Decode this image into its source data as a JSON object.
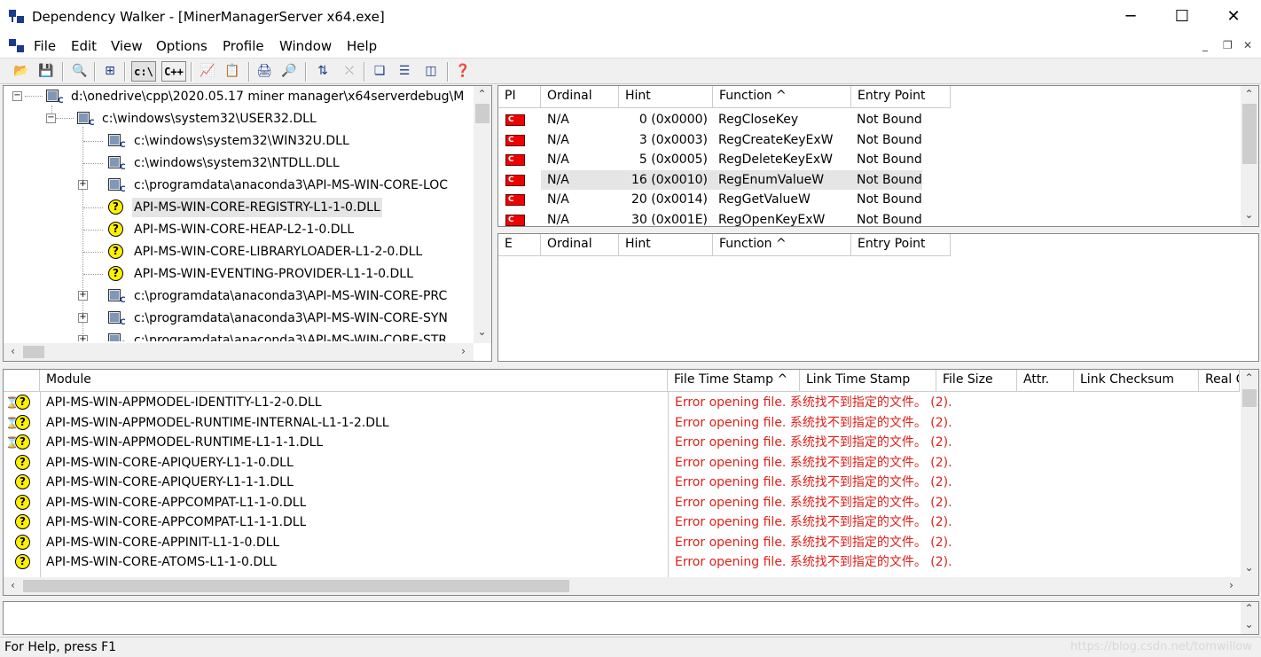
{
  "window": {
    "title": "Dependency Walker - [MinerManagerServer x64.exe]",
    "controls": [
      "─",
      "☐",
      "✕"
    ]
  },
  "menubar": {
    "items": [
      "File",
      "Edit",
      "View",
      "Options",
      "Profile",
      "Window",
      "Help"
    ],
    "mdi_controls": [
      "_",
      "❐",
      "✕"
    ]
  },
  "toolbar": {
    "buttons": [
      {
        "name": "open-icon",
        "glyph": "📂"
      },
      {
        "name": "save-icon",
        "glyph": "💾"
      },
      {
        "name": "find-icon",
        "glyph": "🔍"
      },
      {
        "name": "tree-icon",
        "glyph": "⊞"
      },
      {
        "name": "full-paths-button",
        "glyph": "c:\\"
      },
      {
        "name": "cpp-undecorate-button",
        "glyph": "C++"
      },
      {
        "name": "chart-icon",
        "glyph": "📈"
      },
      {
        "name": "properties-icon",
        "glyph": "📋"
      },
      {
        "name": "print-icon",
        "glyph": "🖨"
      },
      {
        "name": "view-icon",
        "glyph": "🔎"
      },
      {
        "name": "sort-icon",
        "glyph": "⇅"
      },
      {
        "name": "stop-icon",
        "glyph": "⛌"
      },
      {
        "name": "cascade-icon",
        "glyph": "❏"
      },
      {
        "name": "tile-horizontal-icon",
        "glyph": "☰"
      },
      {
        "name": "tile-vertical-icon",
        "glyph": "◫"
      },
      {
        "name": "help-icon",
        "glyph": "❓"
      }
    ]
  },
  "tree": {
    "nodes": [
      {
        "label": "d:\\onedrive\\cpp\\2020.05.17 miner manager\\x64serverdebug\\M",
        "icon": "module",
        "expander": "−"
      },
      {
        "label": "c:\\windows\\system32\\USER32.DLL",
        "icon": "module",
        "expander": "−"
      },
      {
        "label": "c:\\windows\\system32\\WIN32U.DLL",
        "icon": "module",
        "expander": ""
      },
      {
        "label": "c:\\windows\\system32\\NTDLL.DLL",
        "icon": "module",
        "expander": ""
      },
      {
        "label": "c:\\programdata\\anaconda3\\API-MS-WIN-CORE-LOC",
        "icon": "module",
        "expander": "+"
      },
      {
        "label": "API-MS-WIN-CORE-REGISTRY-L1-1-0.DLL",
        "icon": "missing",
        "expander": "",
        "selected": true
      },
      {
        "label": "API-MS-WIN-CORE-HEAP-L2-1-0.DLL",
        "icon": "missing",
        "expander": ""
      },
      {
        "label": "API-MS-WIN-CORE-LIBRARYLOADER-L1-2-0.DLL",
        "icon": "missing",
        "expander": ""
      },
      {
        "label": "API-MS-WIN-EVENTING-PROVIDER-L1-1-0.DLL",
        "icon": "missing",
        "expander": ""
      },
      {
        "label": "c:\\programdata\\anaconda3\\API-MS-WIN-CORE-PRC",
        "icon": "module",
        "expander": "+"
      },
      {
        "label": "c:\\programdata\\anaconda3\\API-MS-WIN-CORE-SYN",
        "icon": "module",
        "expander": "+"
      },
      {
        "label": "c:\\programdata\\anaconda3\\API-MS-WIN-CORE-STR",
        "icon": "module",
        "expander": "+"
      }
    ]
  },
  "imports": {
    "headers": [
      "PI",
      "Ordinal",
      "Hint",
      "Function ^",
      "Entry Point"
    ],
    "rows": [
      {
        "pi": "C",
        "ordinal": "N/A",
        "hint": "0 (0x0000)",
        "function": "RegCloseKey",
        "entry": "Not Bound"
      },
      {
        "pi": "C",
        "ordinal": "N/A",
        "hint": "3 (0x0003)",
        "function": "RegCreateKeyExW",
        "entry": "Not Bound"
      },
      {
        "pi": "C",
        "ordinal": "N/A",
        "hint": "5 (0x0005)",
        "function": "RegDeleteKeyExW",
        "entry": "Not Bound"
      },
      {
        "pi": "C",
        "ordinal": "N/A",
        "hint": "16 (0x0010)",
        "function": "RegEnumValueW",
        "entry": "Not Bound",
        "highlight": true
      },
      {
        "pi": "C",
        "ordinal": "N/A",
        "hint": "20 (0x0014)",
        "function": "RegGetValueW",
        "entry": "Not Bound"
      },
      {
        "pi": "C",
        "ordinal": "N/A",
        "hint": "30 (0x001E)",
        "function": "RegOpenKeyExW",
        "entry": "Not Bound"
      }
    ]
  },
  "exports": {
    "headers": [
      "E",
      "Ordinal",
      "Hint",
      "Function ^",
      "Entry Point"
    ]
  },
  "modules": {
    "headers": [
      "Module",
      "File Time Stamp ^",
      "Link Time Stamp",
      "File Size",
      "Attr.",
      "Link Checksum",
      "Real C"
    ],
    "rows": [
      {
        "icon": "hourglass-missing",
        "module": "API-MS-WIN-APPMODEL-IDENTITY-L1-2-0.DLL",
        "stamp": "Error opening file. 系统找不到指定的文件。 (2)."
      },
      {
        "icon": "hourglass-missing",
        "module": "API-MS-WIN-APPMODEL-RUNTIME-INTERNAL-L1-1-2.DLL",
        "stamp": "Error opening file. 系统找不到指定的文件。 (2)."
      },
      {
        "icon": "hourglass-missing",
        "module": "API-MS-WIN-APPMODEL-RUNTIME-L1-1-1.DLL",
        "stamp": "Error opening file. 系统找不到指定的文件。 (2)."
      },
      {
        "icon": "missing",
        "module": "API-MS-WIN-CORE-APIQUERY-L1-1-0.DLL",
        "stamp": "Error opening file. 系统找不到指定的文件。 (2)."
      },
      {
        "icon": "missing",
        "module": "API-MS-WIN-CORE-APIQUERY-L1-1-1.DLL",
        "stamp": "Error opening file. 系统找不到指定的文件。 (2)."
      },
      {
        "icon": "missing",
        "module": "API-MS-WIN-CORE-APPCOMPAT-L1-1-0.DLL",
        "stamp": "Error opening file. 系统找不到指定的文件。 (2)."
      },
      {
        "icon": "missing",
        "module": "API-MS-WIN-CORE-APPCOMPAT-L1-1-1.DLL",
        "stamp": "Error opening file. 系统找不到指定的文件。 (2)."
      },
      {
        "icon": "missing",
        "module": "API-MS-WIN-CORE-APPINIT-L1-1-0.DLL",
        "stamp": "Error opening file. 系统找不到指定的文件。 (2)."
      },
      {
        "icon": "missing",
        "module": "API-MS-WIN-CORE-ATOMS-L1-1-0.DLL",
        "stamp": "Error opening file. 系统找不到指定的文件。 (2)."
      }
    ]
  },
  "status": {
    "text": "For Help, press F1",
    "watermark": "https://blog.csdn.net/tomwillow"
  },
  "colors": {
    "error": "#e0201a",
    "pi_icon": "#ee0000",
    "missing_icon": "#fff100"
  }
}
